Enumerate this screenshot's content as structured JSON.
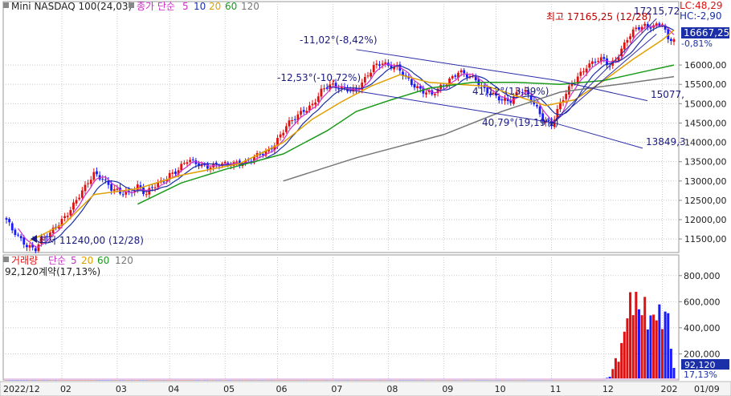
{
  "colors": {
    "up": "#e01010",
    "down": "#1a1aff",
    "ma5": "#cc2fcc",
    "ma10": "#1a2fa8",
    "ma20": "#e0a000",
    "ma60": "#1a9a1a",
    "ma120": "#777777",
    "channel": "#2a2aa8",
    "annot": "#1a1a80",
    "annot_red": "#c00000",
    "grid": "#c8c8c8",
    "price_tag": "#1a2fa8",
    "vol_tag": "#1a2fa8"
  },
  "header": {
    "title": "Mini NASDAQ 100(24,03)",
    "ma_label": "종가 단순",
    "periods": [
      "5",
      "10",
      "20",
      "60",
      "120"
    ]
  },
  "vol_header": {
    "title": "거래량",
    "ma_label": "단순",
    "periods": [
      "5",
      "20",
      "60",
      "120"
    ],
    "value_line": "92,120계약(17,13%)"
  },
  "top_right": {
    "lc": "LC:48,29",
    "hc": "HC:-2,90",
    "last_price": "16667,25",
    "last_change": "-0,81%",
    "vol_tag": "92,120",
    "vol_pct": "17,13%"
  },
  "annotations": {
    "high": "최고 17165,25 (12/28)",
    "high_value": "17215,72",
    "low": "최저 11240,00 (12/28)",
    "a1": "-11,02°(-8,42%)",
    "a2": "-12,53°(-10,72%)",
    "a3": "41,12°(13,39%)",
    "a4": "40,79°(19,19%)",
    "ch1": "15077,",
    "ch2": "13849,3"
  },
  "chart_data": [
    {
      "type": "candlestick",
      "title": "Mini NASDAQ 100(24,03)",
      "x_ticks": [
        "2022/12",
        "02",
        "03",
        "04",
        "05",
        "06",
        "07",
        "08",
        "09",
        "10",
        "11",
        "12",
        "202",
        "01/09"
      ],
      "y_ticks": [
        11500,
        12000,
        12500,
        13000,
        13500,
        14000,
        14500,
        15000,
        15500,
        16000
      ],
      "y_tick_labels": [
        "11500,00",
        "12000,00",
        "12500,00",
        "13000,00",
        "13500,00",
        "14000,00",
        "14500,00",
        "15000,00",
        "15500,00",
        "16000,00"
      ],
      "ylim": [
        11150,
        17350
      ],
      "close_path": [
        [
          0,
          12000
        ],
        [
          2,
          11700
        ],
        [
          5,
          11450
        ],
        [
          7,
          11350
        ],
        [
          10,
          11280
        ],
        [
          12,
          11500
        ],
        [
          15,
          11600
        ],
        [
          17,
          11800
        ],
        [
          21,
          12200
        ],
        [
          25,
          12600
        ],
        [
          27,
          12800
        ],
        [
          30,
          13200
        ],
        [
          33,
          13100
        ],
        [
          36,
          12800
        ],
        [
          39,
          12650
        ],
        [
          42,
          12700
        ],
        [
          45,
          12900
        ],
        [
          48,
          12650
        ],
        [
          50,
          12800
        ],
        [
          53,
          12950
        ],
        [
          56,
          13200
        ],
        [
          59,
          13300
        ],
        [
          62,
          13500
        ],
        [
          66,
          13450
        ],
        [
          70,
          13400
        ],
        [
          75,
          13400
        ],
        [
          79,
          13500
        ],
        [
          82,
          13500
        ],
        [
          84,
          13550
        ],
        [
          87,
          13650
        ],
        [
          90,
          13800
        ],
        [
          93,
          14100
        ],
        [
          96,
          14400
        ],
        [
          99,
          14600
        ],
        [
          102,
          14850
        ],
        [
          105,
          15000
        ],
        [
          108,
          15300
        ],
        [
          111,
          15450
        ],
        [
          114,
          15450
        ],
        [
          117,
          15400
        ],
        [
          120,
          15300
        ],
        [
          123,
          15600
        ],
        [
          126,
          16000
        ],
        [
          129,
          16100
        ],
        [
          131,
          15950
        ],
        [
          134,
          15900
        ],
        [
          137,
          15700
        ],
        [
          140,
          15500
        ],
        [
          143,
          15300
        ],
        [
          146,
          15200
        ],
        [
          149,
          15450
        ],
        [
          152,
          15650
        ],
        [
          155,
          15800
        ],
        [
          158,
          15700
        ],
        [
          161,
          15650
        ],
        [
          164,
          15400
        ],
        [
          167,
          15200
        ],
        [
          170,
          15050
        ],
        [
          173,
          15100
        ],
        [
          176,
          15400
        ],
        [
          178,
          15300
        ],
        [
          181,
          14950
        ],
        [
          184,
          14600
        ],
        [
          187,
          14500
        ],
        [
          190,
          15000
        ],
        [
          193,
          15350
        ],
        [
          196,
          15700
        ],
        [
          199,
          16000
        ],
        [
          202,
          16100
        ],
        [
          205,
          16100
        ],
        [
          207,
          15950
        ],
        [
          210,
          16300
        ],
        [
          213,
          16700
        ],
        [
          216,
          16900
        ],
        [
          219,
          17000
        ],
        [
          222,
          17050
        ],
        [
          225,
          17100
        ],
        [
          227,
          16600
        ],
        [
          229,
          16667.25
        ]
      ],
      "ma_series": [
        {
          "period": "20",
          "points": [
            [
              8,
              11450
            ],
            [
              20,
              11900
            ],
            [
              30,
              12650
            ],
            [
              45,
              12800
            ],
            [
              60,
              13150
            ],
            [
              80,
              13450
            ],
            [
              95,
              14000
            ],
            [
              105,
              14600
            ],
            [
              115,
              15050
            ],
            [
              125,
              15450
            ],
            [
              135,
              15750
            ],
            [
              145,
              15550
            ],
            [
              155,
              15500
            ],
            [
              165,
              15450
            ],
            [
              175,
              15200
            ],
            [
              185,
              14950
            ],
            [
              195,
              15100
            ],
            [
              205,
              15600
            ],
            [
              215,
              16150
            ],
            [
              225,
              16650
            ],
            [
              229,
              16900
            ]
          ]
        },
        {
          "period": "60",
          "points": [
            [
              45,
              12400
            ],
            [
              60,
              12950
            ],
            [
              75,
              13300
            ],
            [
              95,
              13700
            ],
            [
              110,
              14300
            ],
            [
              120,
              14800
            ],
            [
              132,
              15100
            ],
            [
              145,
              15400
            ],
            [
              160,
              15550
            ],
            [
              175,
              15550
            ],
            [
              190,
              15500
            ],
            [
              205,
              15600
            ],
            [
              220,
              15850
            ],
            [
              229,
              16000
            ]
          ]
        },
        {
          "period": "120",
          "points": [
            [
              95,
              13000
            ],
            [
              120,
              13600
            ],
            [
              150,
              14200
            ],
            [
              170,
              14800
            ],
            [
              190,
              15300
            ],
            [
              210,
              15500
            ],
            [
              229,
              15700
            ]
          ]
        }
      ],
      "trend_channels": [
        {
          "label": "-11,02°(-8,42%)",
          "points": [
            [
              120,
              16400
            ],
            [
              189,
              15600
            ]
          ]
        },
        {
          "label": "-12,53°(-10,72%)",
          "points": [
            [
              110,
              15450
            ],
            [
              188,
              14500
            ]
          ]
        },
        {
          "label": "41,12°(13,39%)",
          "points": [
            [
              188,
              14550
            ],
            [
              223,
              17200
            ]
          ]
        },
        {
          "label": "40,79°(19,19%)",
          "points": [
            [
              186,
              14400
            ],
            [
              223,
              16800
            ]
          ]
        }
      ],
      "extremes": {
        "high": 17165.25,
        "high_date": "12/28",
        "low": 11240.0,
        "low_date": "12/28"
      }
    },
    {
      "type": "bar",
      "title": "거래량",
      "y_ticks": [
        200000,
        400000,
        600000,
        800000
      ],
      "y_tick_labels": [
        "200,000",
        "400,000",
        "600,000",
        "800,000"
      ],
      "ylim": [
        0,
        860000
      ],
      "volume_path": [
        [
          0,
          1000
        ],
        [
          205,
          2000
        ],
        [
          207,
          30000
        ],
        [
          209,
          170000
        ],
        [
          211,
          290000
        ],
        [
          213,
          580000
        ],
        [
          215,
          780000
        ],
        [
          217,
          620000
        ],
        [
          219,
          640000
        ],
        [
          221,
          520000
        ],
        [
          223,
          600000
        ],
        [
          225,
          560000
        ],
        [
          227,
          560000
        ],
        [
          229,
          92120
        ]
      ],
      "last_volume": 92120
    }
  ]
}
